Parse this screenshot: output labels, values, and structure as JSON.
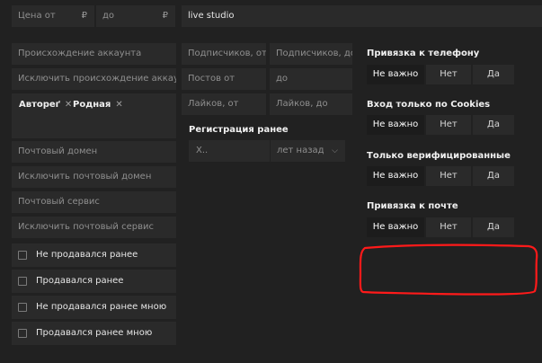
{
  "price": {
    "from_placeholder": "Цена от",
    "to_placeholder": "до",
    "currency": "₽"
  },
  "search_value": "live studio",
  "left": {
    "origin_placeholder": "Происхождение аккаунта",
    "exclude_origin_placeholder": "Исключить происхождение аккаунт",
    "tags": [
      "Автореґ",
      "Родная"
    ],
    "mail_domain_placeholder": "Почтовый домен",
    "exclude_mail_domain_placeholder": "Исключить почтовый домен",
    "mail_service_placeholder": "Почтовый сервис",
    "exclude_mail_service_placeholder": "Исключить почтовый сервис",
    "checkboxes": [
      "Не продавался ранее",
      "Продавался ранее",
      "Не продавался ранее мною",
      "Продавался ранее мною"
    ]
  },
  "middle": {
    "subscribers_from": "Подписчиков, от",
    "subscribers_to": "Подписчиков, до",
    "posts_from": "Постов от",
    "posts_to": "до",
    "likes_from": "Лайков, от",
    "likes_to": "Лайков, до",
    "registration_title": "Регистрация ранее",
    "registration_value_placeholder": "X..",
    "registration_unit": "лет назад"
  },
  "right": {
    "groups": [
      {
        "title": "Привязка к телефону",
        "options": [
          "Не важно",
          "Нет",
          "Да"
        ],
        "selected": 0
      },
      {
        "title": "Вход только по Cookies",
        "options": [
          "Не важно",
          "Нет",
          "Да"
        ],
        "selected": 0
      },
      {
        "title": "Только верифицированные",
        "options": [
          "Не важно",
          "Нет",
          "Да"
        ],
        "selected": 0
      },
      {
        "title": "Привязка к почте",
        "options": [
          "Не важно",
          "Нет",
          "Да"
        ],
        "selected": 0
      }
    ]
  },
  "colors": {
    "background": "#212121",
    "field": "#2a2a2a",
    "highlight_circle": "#ff0000"
  }
}
